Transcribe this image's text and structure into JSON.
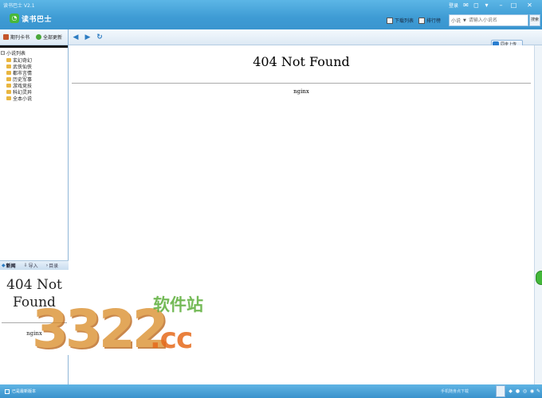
{
  "window": {
    "title": "读书巴士 V2.1",
    "logo_text": "读书巴士",
    "login_label": "登录"
  },
  "header": {
    "tabs": [
      {
        "label": "下载列表"
      },
      {
        "label": "排行榜"
      }
    ],
    "search": {
      "category": "小说",
      "placeholder": "请输入小说名",
      "button_label": "搜索"
    }
  },
  "sidebar": {
    "tabs": [
      {
        "label": "期刊卡书"
      },
      {
        "label": "全部更新"
      }
    ],
    "tree": {
      "root_label": "小说列表",
      "items": [
        {
          "label": "玄幻奇幻"
        },
        {
          "label": "武侠仙侠"
        },
        {
          "label": "都市言情"
        },
        {
          "label": "历史军事"
        },
        {
          "label": "游戏竞技"
        },
        {
          "label": "科幻灵异"
        },
        {
          "label": "全本小说"
        }
      ]
    },
    "preview_tabs": [
      {
        "label": "新闻"
      },
      {
        "label": "导入"
      },
      {
        "label": "目录"
      }
    ],
    "preview": {
      "heading": "404 Not Found",
      "footer": "nginx"
    }
  },
  "toolbar": {
    "sync_label": "同步上传"
  },
  "main": {
    "heading": "404 Not Found",
    "footer": "nginx"
  },
  "statusbar": {
    "left_text": "已是最新版本",
    "mid_text": "手机随身点下载"
  },
  "watermark": {
    "number": "3322",
    "cn_text": "软件站",
    "suffix": ".cc"
  },
  "colors": {
    "titlebar": "#3e9bd4",
    "accent": "#2c7cc2",
    "folder": "#e9b640"
  }
}
